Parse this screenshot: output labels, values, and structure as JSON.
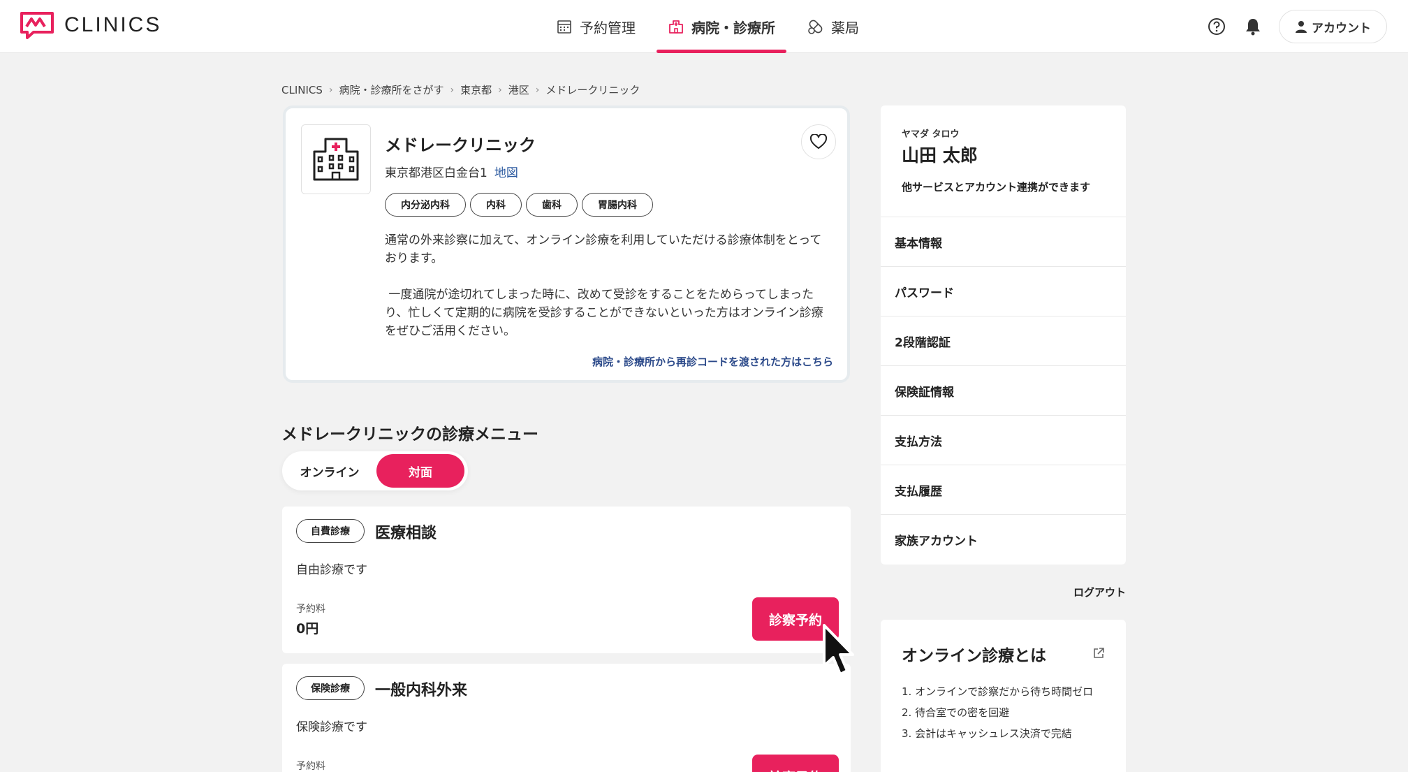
{
  "header": {
    "logo_text": "CLINICS",
    "nav": [
      {
        "label": "予約管理",
        "icon": "calendar-icon"
      },
      {
        "label": "病院・診療所",
        "icon": "hospital-icon",
        "active": true
      },
      {
        "label": "薬局",
        "icon": "pill-icon"
      }
    ],
    "help_icon": "help-icon",
    "bell_icon": "bell-icon",
    "account_label": "アカウント"
  },
  "breadcrumb": [
    "CLINICS",
    "病院・診療所をさがす",
    "東京都",
    "港区",
    "メドレークリニック"
  ],
  "clinic": {
    "name": "メドレークリニック",
    "address": "東京都港区白金台1",
    "map_label": "地図",
    "tags": [
      "内分泌内科",
      "内科",
      "歯科",
      "胃腸内科"
    ],
    "description": "通常の外来診察に加えて、オンライン診療を利用していただける診療体制をとっております。\n\n 一度通院が途切れてしまった時に、改めて受診をすることをためらってしまったり、忙しくて定期的に病院を受診することができないといった方はオンライン診療をぜひご活用ください。",
    "revisit_link": "病院・診療所から再診コードを渡された方はこちら"
  },
  "menu": {
    "title": "メドレークリニックの診療メニュー",
    "toggle": {
      "online": "オンライン",
      "in_person": "対面"
    },
    "items": [
      {
        "badge": "自費診療",
        "name": "医療相談",
        "desc": "自由診療です",
        "fee_label": "予約料",
        "fee": "0円",
        "button": "診察予約"
      },
      {
        "badge": "保険診療",
        "name": "一般内科外来",
        "desc": "保険診療です",
        "fee_label": "予約料",
        "fee": "",
        "button": "診察予約"
      }
    ]
  },
  "profile": {
    "kana": "ヤマダ タロウ",
    "name": "山田 太郎",
    "note": "他サービスとアカウント連携ができます",
    "items": [
      "基本情報",
      "パスワード",
      "2段階認証",
      "保険証情報",
      "支払方法",
      "支払履歴",
      "家族アカウント"
    ],
    "logout": "ログアウト"
  },
  "online_info": {
    "title": "オンライン診療とは",
    "points": [
      "1. オンラインで診察だから待ち時間ゼロ",
      "2. 待合室での密を回避",
      "3. 会計はキャッシュレス決済で完結"
    ]
  },
  "colors": {
    "accent": "#e8215d",
    "link": "#2c5aa0"
  }
}
